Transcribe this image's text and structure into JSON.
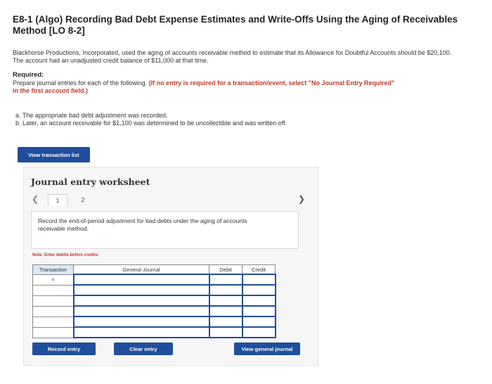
{
  "problem": {
    "title": "E8-1 (Algo) Recording Bad Debt Expense Estimates and Write-Offs Using the Aging of Receivables Method [LO 8-2]",
    "intro": "Blackhorse Productions, Incorporated, used the aging of accounts receivable method to estimate that its Allowance for Doubtful Accounts should be $20,100. The account had an unadjusted credit balance of $11,000 at that time.",
    "required_label": "Required:",
    "required_text": "Prepare journal entries for each of the following.",
    "required_warning": "(If no entry is required for a transaction/event, select \"No Journal Entry Required\"",
    "required_warning_tail": "in the first account field.)",
    "part_a": "a. The appropriate bad debt adjustment was recorded.",
    "part_b": "b. Later, an account receivable for $1,100 was determined to be uncollectible and was written off."
  },
  "buttons": {
    "view_transaction_list": "View transaction list",
    "record_entry": "Record entry",
    "clear_entry": "Clear entry",
    "view_general_journal": "View general journal"
  },
  "worksheet": {
    "title": "Journal entry worksheet",
    "prev_icon": "chevron-left-icon",
    "next_icon": "chevron-right-icon",
    "tabs": [
      "1",
      "2"
    ],
    "active_tab": "1",
    "instruction": "Record the end-of-period adjustment for bad debts under the aging of accounts receivable method.",
    "note": "Note: Enter debits before credits."
  },
  "journal_table": {
    "headers": [
      "Transaction",
      "General Journal",
      "Debit",
      "Credit"
    ],
    "rows": [
      {
        "transaction": "a",
        "account": "",
        "debit": "",
        "credit": ""
      },
      {
        "transaction": "",
        "account": "",
        "debit": "",
        "credit": ""
      },
      {
        "transaction": "",
        "account": "",
        "debit": "",
        "credit": ""
      },
      {
        "transaction": "",
        "account": "",
        "debit": "",
        "credit": ""
      },
      {
        "transaction": "",
        "account": "",
        "debit": "",
        "credit": ""
      },
      {
        "transaction": "",
        "account": "",
        "debit": "",
        "credit": ""
      }
    ]
  },
  "colors": {
    "button_blue": "#1f4e9c",
    "warning_red": "#c0392b",
    "header_blue": "#d9e8f7"
  }
}
